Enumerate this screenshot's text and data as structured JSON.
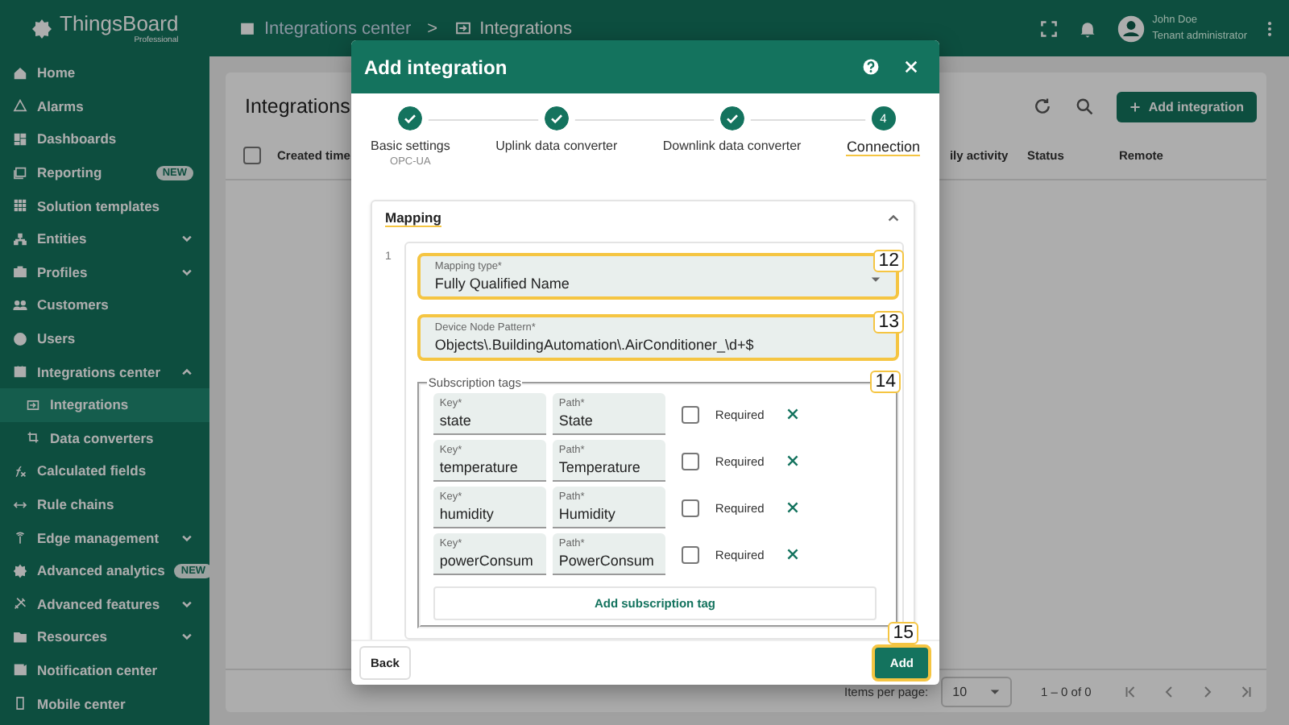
{
  "app": {
    "logo": "ThingsBoard",
    "edition": "Professional"
  },
  "breadcrumbs": {
    "items": [
      {
        "label": "Integrations center"
      },
      {
        "label": "Integrations"
      }
    ],
    "separator": ">"
  },
  "user": {
    "name": "John Doe",
    "role": "Tenant administrator"
  },
  "sidebar": {
    "items": [
      {
        "label": "Home",
        "selected": false
      },
      {
        "label": "Alarms",
        "selected": false
      },
      {
        "label": "Dashboards",
        "selected": false
      },
      {
        "label": "Reporting",
        "selected": false,
        "badge": "NEW"
      },
      {
        "label": "Solution templates",
        "selected": false
      },
      {
        "label": "Entities",
        "selected": false,
        "expanded": false
      },
      {
        "label": "Profiles",
        "selected": false,
        "expanded": false
      },
      {
        "label": "Customers",
        "selected": false
      },
      {
        "label": "Users",
        "selected": false
      },
      {
        "label": "Integrations center",
        "selected": false,
        "expanded": true,
        "children": [
          {
            "label": "Integrations",
            "selected": true
          },
          {
            "label": "Data converters",
            "selected": false
          }
        ]
      },
      {
        "label": "Calculated fields",
        "selected": false
      },
      {
        "label": "Rule chains",
        "selected": false
      },
      {
        "label": "Edge management",
        "selected": false,
        "expanded": false
      },
      {
        "label": "Advanced analytics",
        "selected": false,
        "badge": "NEW"
      },
      {
        "label": "Advanced features",
        "selected": false,
        "expanded": false
      },
      {
        "label": "Resources",
        "selected": false,
        "expanded": false
      },
      {
        "label": "Notification center",
        "selected": false
      },
      {
        "label": "Mobile center",
        "selected": false
      }
    ]
  },
  "page": {
    "title": "Integrations",
    "add_button": "Add integration"
  },
  "table": {
    "select_all_checked": false,
    "columns": [
      "Created time",
      "ily activity",
      "Status",
      "Remote"
    ]
  },
  "paginator": {
    "items_per_page_label": "Items per page:",
    "page_size": "10",
    "range": "1 – 0 of 0"
  },
  "dialog": {
    "title": "Add integration",
    "steps": [
      {
        "label": "Basic settings",
        "sublabel": "OPC-UA",
        "completed": true,
        "selected": false
      },
      {
        "label": "Uplink data converter",
        "completed": true,
        "selected": false
      },
      {
        "label": "Downlink data converter",
        "completed": true,
        "selected": false
      },
      {
        "label": "Connection",
        "number": "4",
        "completed": false,
        "selected": true
      }
    ],
    "panel": {
      "title": "Mapping",
      "expanded": true,
      "mappings": [
        {
          "index": "1",
          "mapping_type": {
            "label": "Mapping type*",
            "value": "Fully Qualified Name",
            "callout": "12"
          },
          "device_node_pattern": {
            "label": "Device Node Pattern*",
            "value": "Objects\\.BuildingAutomation\\.AirConditioner_\\d+$",
            "callout": "13"
          },
          "subscription_tags": {
            "label": "Subscription tags",
            "callout": "14",
            "add_label": "Add subscription tag",
            "tags": [
              {
                "key_label": "Key*",
                "key": "state",
                "path_label": "Path*",
                "path": "State",
                "required_label": "Required",
                "required": false
              },
              {
                "key_label": "Key*",
                "key": "temperature",
                "path_label": "Path*",
                "path": "Temperature",
                "required_label": "Required",
                "required": false
              },
              {
                "key_label": "Key*",
                "key": "humidity",
                "path_label": "Path*",
                "path": "Humidity",
                "required_label": "Required",
                "required": false
              },
              {
                "key_label": "Key*",
                "key": "powerConsum",
                "path_label": "Path*",
                "path": "PowerConsum",
                "required_label": "Required",
                "required": false
              }
            ]
          }
        }
      ]
    },
    "back_button": "Back",
    "add_button": {
      "label": "Add",
      "callout": "15"
    }
  }
}
